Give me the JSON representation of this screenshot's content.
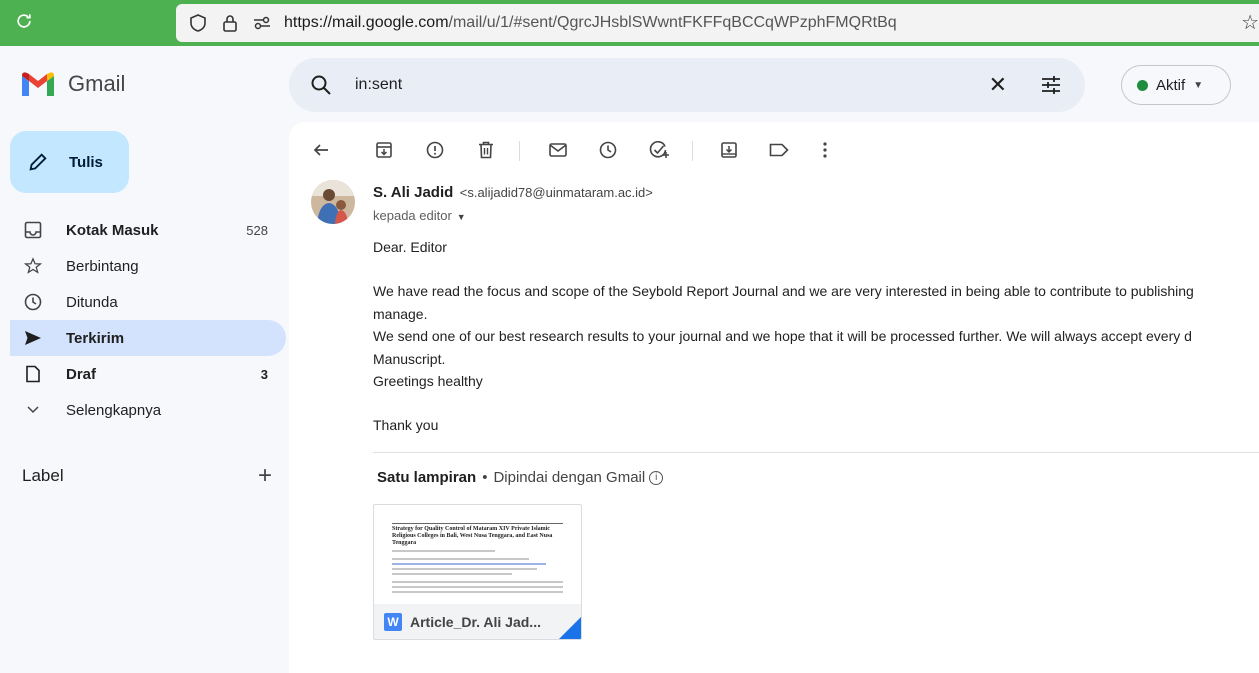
{
  "browser": {
    "url_host": "https://mail.google.com",
    "url_path": "/mail/u/1/#sent/QgrcJHsblSWwntFKFFqBCCqWPzphFMQRtBq"
  },
  "app": {
    "name": "Gmail"
  },
  "compose": {
    "label": "Tulis"
  },
  "nav": [
    {
      "label": "Kotak Masuk",
      "count": "528",
      "icon": "inbox-icon"
    },
    {
      "label": "Berbintang",
      "count": "",
      "icon": "star-icon"
    },
    {
      "label": "Ditunda",
      "count": "",
      "icon": "clock-icon"
    },
    {
      "label": "Terkirim",
      "count": "",
      "icon": "send-icon",
      "active": true
    },
    {
      "label": "Draf",
      "count": "3",
      "icon": "draft-icon"
    },
    {
      "label": "Selengkapnya",
      "count": "",
      "icon": "chevron-down-icon"
    }
  ],
  "labels": {
    "title": "Label"
  },
  "search": {
    "query": "in:sent"
  },
  "status": {
    "label": "Aktif",
    "color": "#1e8e3e"
  },
  "email": {
    "sender_name": "S. Ali Jadid",
    "sender_email": "<s.alijadid78@uinmataram.ac.id>",
    "recipient": "kepada editor",
    "body": {
      "greeting": "Dear. Editor",
      "para1_line1": "We have read the focus and scope of the Seybold Report Journal and we are very interested in being able to contribute to publishing",
      "para1_line2": "manage.",
      "para2_line1": "We send one of our best research results to your journal and we hope that it will be processed further. We will always accept every d",
      "para2_line2": "Manuscript.",
      "line3": "Greetings healthy",
      "closing": "Thank you"
    }
  },
  "attachments": {
    "count_label": "Satu lampiran",
    "scan_label": "Dipindai dengan Gmail",
    "file": {
      "name": "Article_Dr. Ali Jad...",
      "type_letter": "W",
      "preview_title": "Strategy for Quality Control of Mataram XIV Private Islamic Religious Colleges in Bali, West Nusa Tenggara, and East Nusa Tenggara"
    }
  }
}
